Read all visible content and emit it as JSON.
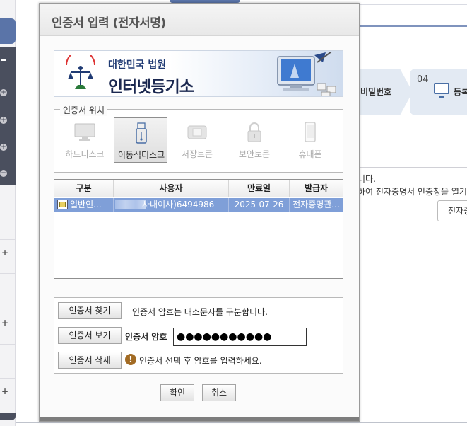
{
  "background": {
    "step3_label": "비밀번호",
    "step4_number": "04",
    "step4_label": "등록",
    "notice_line1": "니다.",
    "notice_line2": "하여 전자증명서 인증창을 열기 버",
    "side_button_label": "전자증명"
  },
  "dialog": {
    "title": "인증서 입력 (전자서명)",
    "banner": {
      "org_name": "대한민국 법원",
      "system_name": "인터넷등기소"
    },
    "location": {
      "legend": "인증서 위치",
      "media": [
        {
          "label": "하드디스크",
          "icon": "monitor-icon",
          "selected": false
        },
        {
          "label": "이동식디스크",
          "icon": "usb-drive-icon",
          "selected": true
        },
        {
          "label": "저장토큰",
          "icon": "token-icon",
          "selected": false
        },
        {
          "label": "보안토큰",
          "icon": "lock-icon",
          "selected": false
        },
        {
          "label": "휴대폰",
          "icon": "phone-icon",
          "selected": false
        }
      ]
    },
    "table": {
      "columns": [
        "구분",
        "사용자",
        "만료일",
        "발급자"
      ],
      "rows": [
        {
          "type": "일반인...",
          "user": "사내이사)6494986",
          "expiry": "2025-07-26",
          "issuer": "전자증명관..."
        }
      ]
    },
    "buttons": {
      "find": "인증서 찾기",
      "view": "인증서 보기",
      "delete": "인증서 삭제",
      "ok": "확인",
      "cancel": "취소"
    },
    "case_hint": "인증서 암호는 대소문자를 구분합니다.",
    "password_label": "인증서 암호",
    "password_value": "●●●●●●●●●●●",
    "select_hint": "인증서 선택 후 암호를 입력하세요.",
    "colors": {
      "selected_row": "#7f9fd8",
      "banner_navy": "#1b2850",
      "warning": "#a26b24"
    }
  }
}
